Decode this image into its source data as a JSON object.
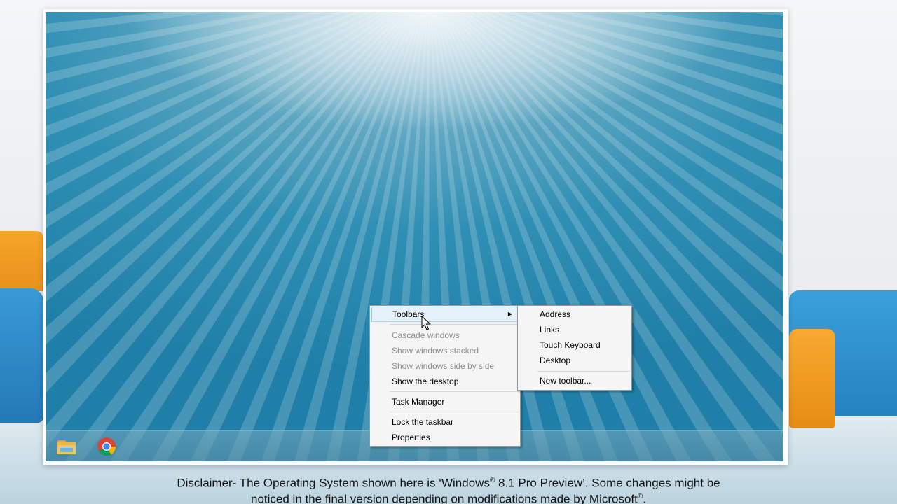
{
  "desktop": {
    "taskbar": {
      "items": [
        {
          "name": "file-explorer",
          "icon": "folder-icon"
        },
        {
          "name": "chrome",
          "icon": "chrome-icon"
        }
      ]
    }
  },
  "context_menu": {
    "items": [
      {
        "label": "Toolbars",
        "state": "highlighted",
        "has_submenu": true
      },
      {
        "label": "Cascade windows",
        "state": "disabled"
      },
      {
        "label": "Show windows stacked",
        "state": "disabled"
      },
      {
        "label": "Show windows side by side",
        "state": "disabled"
      },
      {
        "label": "Show the desktop",
        "state": "enabled"
      },
      {
        "label": "Task Manager",
        "state": "enabled"
      },
      {
        "label": "Lock the taskbar",
        "state": "enabled"
      },
      {
        "label": "Properties",
        "state": "enabled"
      }
    ]
  },
  "toolbars_submenu": {
    "items": [
      {
        "label": "Address"
      },
      {
        "label": "Links"
      },
      {
        "label": "Touch Keyboard"
      },
      {
        "label": "Desktop"
      },
      {
        "label": "New toolbar..."
      }
    ]
  },
  "disclaimer": {
    "part1": "Disclaimer- The Operating System shown here is ‘Windows",
    "reg1": "®",
    "part2": " 8.1 Pro Preview’. Some changes might be",
    "part3": "noticed in the final version depending on modifications made by Microsoft",
    "reg2": "®",
    "part4": "."
  },
  "colors": {
    "menu_bg": "#f5f5f5",
    "menu_highlight": "#e5f1fb",
    "menu_highlight_border": "#a8cfee",
    "disabled_text": "#8d8d8d",
    "accent_orange": "#f7a52a",
    "accent_blue": "#2f8fb4"
  }
}
